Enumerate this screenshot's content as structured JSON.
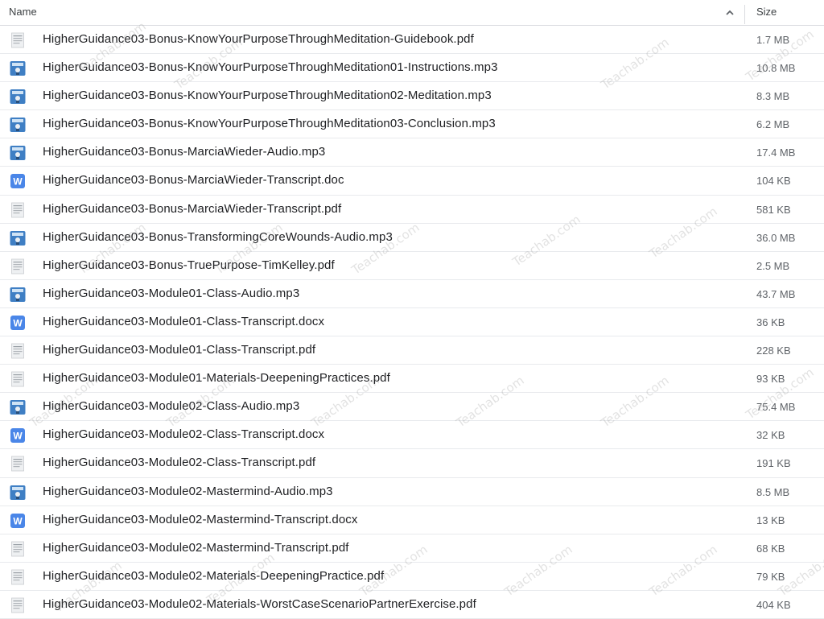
{
  "header": {
    "name_label": "Name",
    "size_label": "Size",
    "sort_icon": "chevron-up-icon"
  },
  "watermark": "Teachab.com",
  "files": [
    {
      "name": "HigherGuidance03-Bonus-KnowYourPurposeThroughMeditation-Guidebook.pdf",
      "size": "1.7 MB",
      "icon": "pdf-thumbnail-icon"
    },
    {
      "name": "HigherGuidance03-Bonus-KnowYourPurposeThroughMeditation01-Instructions.mp3",
      "size": "10.8 MB",
      "icon": "audio-thumbnail-icon"
    },
    {
      "name": "HigherGuidance03-Bonus-KnowYourPurposeThroughMeditation02-Meditation.mp3",
      "size": "8.3 MB",
      "icon": "audio-thumbnail-icon"
    },
    {
      "name": "HigherGuidance03-Bonus-KnowYourPurposeThroughMeditation03-Conclusion.mp3",
      "size": "6.2 MB",
      "icon": "audio-thumbnail-icon"
    },
    {
      "name": "HigherGuidance03-Bonus-MarciaWieder-Audio.mp3",
      "size": "17.4 MB",
      "icon": "audio-thumbnail-icon"
    },
    {
      "name": "HigherGuidance03-Bonus-MarciaWieder-Transcript.doc",
      "size": "104 KB",
      "icon": "word-icon"
    },
    {
      "name": "HigherGuidance03-Bonus-MarciaWieder-Transcript.pdf",
      "size": "581 KB",
      "icon": "pdf-thumbnail-icon"
    },
    {
      "name": "HigherGuidance03-Bonus-TransformingCoreWounds-Audio.mp3",
      "size": "36.0 MB",
      "icon": "audio-thumbnail-icon"
    },
    {
      "name": "HigherGuidance03-Bonus-TruePurpose-TimKelley.pdf",
      "size": "2.5 MB",
      "icon": "pdf-thumbnail-icon"
    },
    {
      "name": "HigherGuidance03-Module01-Class-Audio.mp3",
      "size": "43.7 MB",
      "icon": "audio-thumbnail-icon"
    },
    {
      "name": "HigherGuidance03-Module01-Class-Transcript.docx",
      "size": "36 KB",
      "icon": "word-icon"
    },
    {
      "name": "HigherGuidance03-Module01-Class-Transcript.pdf",
      "size": "228 KB",
      "icon": "pdf-thumbnail-icon"
    },
    {
      "name": "HigherGuidance03-Module01-Materials-DeepeningPractices.pdf",
      "size": "93 KB",
      "icon": "pdf-thumbnail-icon"
    },
    {
      "name": "HigherGuidance03-Module02-Class-Audio.mp3",
      "size": "75.4 MB",
      "icon": "audio-thumbnail-icon"
    },
    {
      "name": "HigherGuidance03-Module02-Class-Transcript.docx",
      "size": "32 KB",
      "icon": "word-icon"
    },
    {
      "name": "HigherGuidance03-Module02-Class-Transcript.pdf",
      "size": "191 KB",
      "icon": "pdf-thumbnail-icon"
    },
    {
      "name": "HigherGuidance03-Module02-Mastermind-Audio.mp3",
      "size": "8.5 MB",
      "icon": "audio-thumbnail-icon"
    },
    {
      "name": "HigherGuidance03-Module02-Mastermind-Transcript.docx",
      "size": "13 KB",
      "icon": "word-icon"
    },
    {
      "name": "HigherGuidance03-Module02-Mastermind-Transcript.pdf",
      "size": "68 KB",
      "icon": "pdf-thumbnail-icon"
    },
    {
      "name": "HigherGuidance03-Module02-Materials-DeepeningPractice.pdf",
      "size": "79 KB",
      "icon": "pdf-thumbnail-icon"
    },
    {
      "name": "HigherGuidance03-Module02-Materials-WorstCaseScenarioPartnerExercise.pdf",
      "size": "404 KB",
      "icon": "pdf-thumbnail-icon"
    }
  ]
}
